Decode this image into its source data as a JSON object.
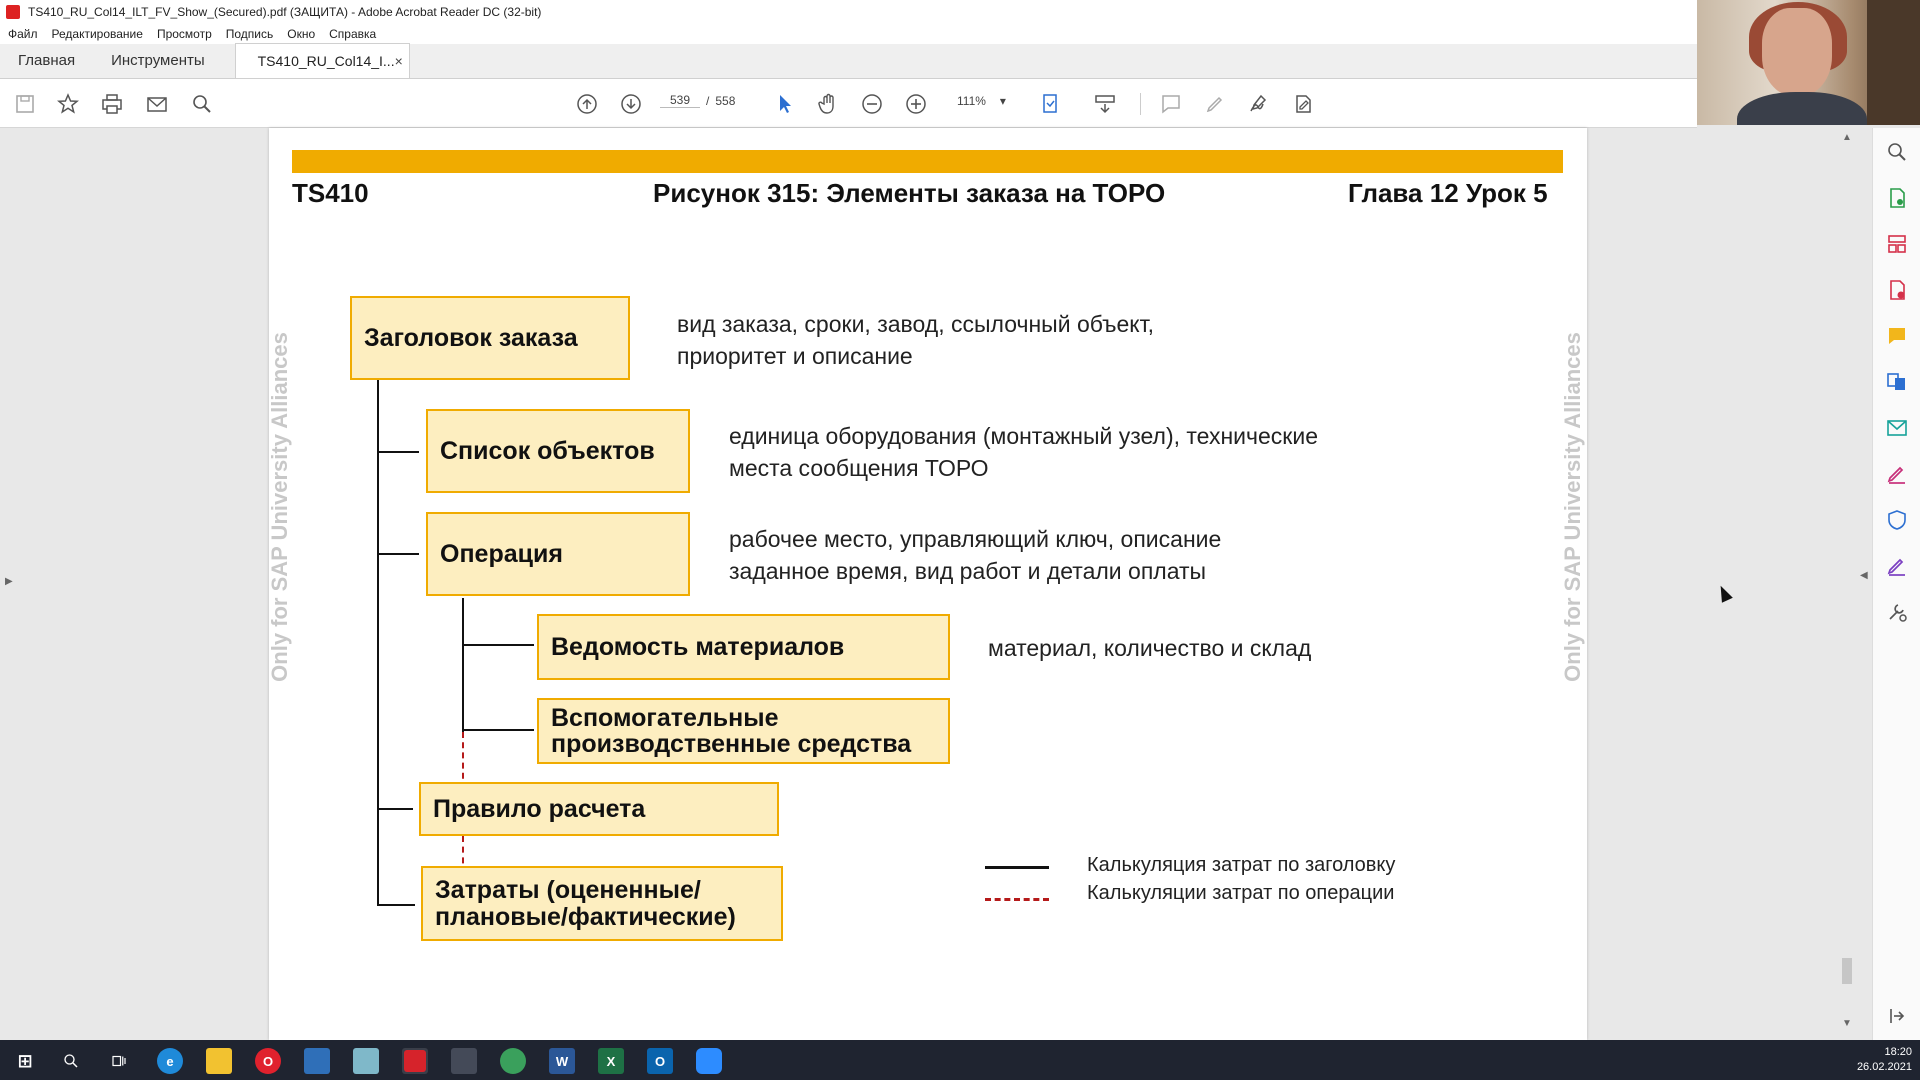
{
  "window": {
    "title": "TS410_RU_Col14_ILT_FV_Show_(Secured).pdf (ЗАЩИТА) - Adobe Acrobat Reader DC (32-bit)"
  },
  "menu": [
    "Файл",
    "Редактирование",
    "Просмотр",
    "Подпись",
    "Окно",
    "Справка"
  ],
  "tabs": {
    "home": "Главная",
    "tools": "Инструменты",
    "document": "TS410_RU_Col14_I...",
    "close": "×"
  },
  "toolbar": {
    "current_page": "539",
    "separator": "/",
    "total_pages": "558",
    "zoom": "111%"
  },
  "page": {
    "header_left": "TS410",
    "header_center": "Рисунок 315: Элементы заказа на ТОРО",
    "header_right": "Глава 12 Урок 5",
    "watermark": "Only for SAP University Alliances",
    "boxes": {
      "order_header": "Заголовок заказа",
      "object_list": "Список объектов",
      "operation": "Операция",
      "material_list": "Ведомость материалов",
      "prt": [
        "Вспомогательные",
        "производственные средства"
      ],
      "settlement_rule": "Правило расчета",
      "costs": [
        "Затраты (оцененные/",
        "плановые/фактические)"
      ]
    },
    "descriptions": {
      "order_header": [
        "вид заказа, сроки, завод, ссылочный объект,",
        "приоритет и описание"
      ],
      "object_list": [
        "единица оборудования (монтажный узел), технические",
        "места сообщения ТОРО"
      ],
      "operation": [
        "рабочее место, управляющий ключ, описание",
        "заданное время, вид работ и детали оплаты"
      ],
      "material_list": "материал, количество и склад"
    },
    "legend": {
      "solid": "Калькуляция затрат по заголовку",
      "dashed": "Калькуляции затрат по операции"
    }
  },
  "taskbar": {
    "time": "18:20",
    "date": "26.02.2021"
  },
  "colors": {
    "accent": "#f0ab00",
    "box_fill": "#fdeec0",
    "dashed_line": "#b51a1a"
  }
}
